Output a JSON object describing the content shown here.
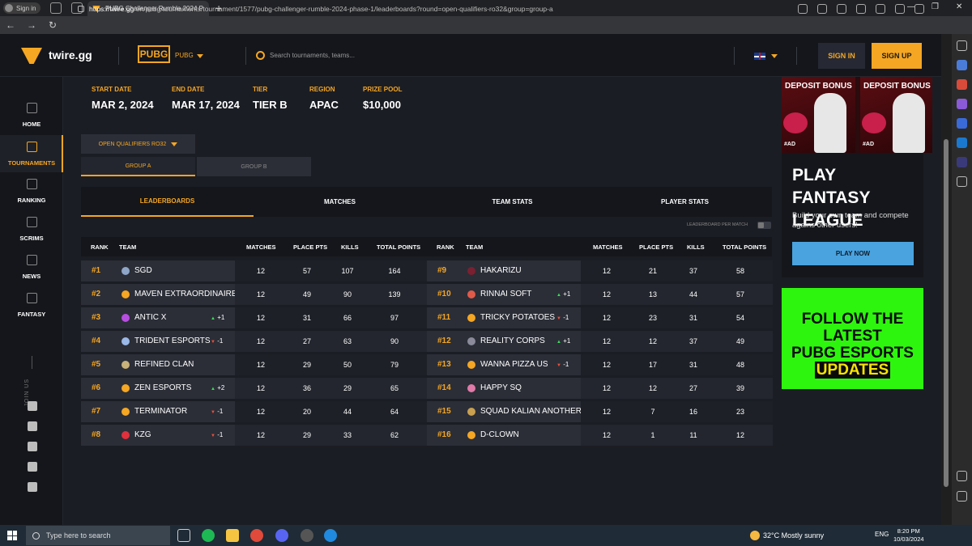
{
  "browser": {
    "profile_label": "Sign in",
    "tab_title": "PUBG Challenger Rumble 2024 P",
    "url_host": "https://twire.gg",
    "url_path": "/en/pubg/tournaments/tournament/1577/pubg-challenger-rumble-2024-phase-1/leaderboards?round=open-qualifiers-ro32&group=group-a"
  },
  "header": {
    "logo_text": "twire.gg",
    "game_logo": "PUBG",
    "game_name": "PUBG",
    "search_placeholder": "Search tournaments, teams...",
    "language_flag": "uk-flag-icon",
    "signin_label": "SIGN IN",
    "signup_label": "SIGN UP"
  },
  "sidebar": {
    "items": [
      {
        "label": "HOME",
        "icon": "home-icon"
      },
      {
        "label": "TOURNAMENTS",
        "icon": "trophy-icon"
      },
      {
        "label": "RANKING",
        "icon": "ranking-icon"
      },
      {
        "label": "SCRIMS",
        "icon": "crossed-swords-icon"
      },
      {
        "label": "NEWS",
        "icon": "news-icon"
      },
      {
        "label": "FANTASY",
        "icon": "shield-icon"
      }
    ],
    "join_us": "JOIN US",
    "social": [
      "facebook-icon",
      "twitter-icon",
      "discord-icon",
      "instagram-icon",
      "linkedin-icon"
    ]
  },
  "tournament": {
    "start_label": "START DATE",
    "start_value": "MAR 2, 2024",
    "end_label": "END DATE",
    "end_value": "MAR 17, 2024",
    "tier_label": "TIER",
    "tier_value": "TIER B",
    "region_label": "REGION",
    "region_value": "APAC",
    "prize_label": "PRIZE POOL",
    "prize_value": "$10,000"
  },
  "round_select": "OPEN QUALIFIERS RO32",
  "groups": [
    "GROUP A",
    "GROUP B"
  ],
  "tabs": [
    "LEADERBOARDS",
    "MATCHES",
    "TEAM STATS",
    "PLAYER STATS"
  ],
  "leaderboard_toggle_label": "LEADERBOARD PER MATCH",
  "columns": [
    "RANK",
    "TEAM",
    "MATCHES",
    "PLACE PTS",
    "KILLS",
    "TOTAL POINTS"
  ],
  "left_rows": [
    {
      "rank": "#1",
      "team": "SGD",
      "change": "",
      "dir": "",
      "matches": "12",
      "place": "57",
      "kills": "107",
      "total": "164",
      "color": "#8fa6c8"
    },
    {
      "rank": "#2",
      "team": "MAVEN EXTRAORDINAIRE",
      "change": "",
      "dir": "",
      "matches": "12",
      "place": "49",
      "kills": "90",
      "total": "139",
      "color": "#f5a623"
    },
    {
      "rank": "#3",
      "team": "ANTIC X",
      "change": "+1",
      "dir": "up",
      "matches": "12",
      "place": "31",
      "kills": "66",
      "total": "97",
      "color": "#b84ee0"
    },
    {
      "rank": "#4",
      "team": "TRIDENT ESPORTS",
      "change": "-1",
      "dir": "down",
      "matches": "12",
      "place": "27",
      "kills": "63",
      "total": "90",
      "color": "#9ab8e8"
    },
    {
      "rank": "#5",
      "team": "REFINED CLAN",
      "change": "",
      "dir": "",
      "matches": "12",
      "place": "29",
      "kills": "50",
      "total": "79",
      "color": "#c8b27a"
    },
    {
      "rank": "#6",
      "team": "ZEN ESPORTS",
      "change": "+2",
      "dir": "up",
      "matches": "12",
      "place": "36",
      "kills": "29",
      "total": "65",
      "color": "#f5a623"
    },
    {
      "rank": "#7",
      "team": "TERMINATOR",
      "change": "-1",
      "dir": "down",
      "matches": "12",
      "place": "20",
      "kills": "44",
      "total": "64",
      "color": "#f5a623"
    },
    {
      "rank": "#8",
      "team": "KZG",
      "change": "-1",
      "dir": "down",
      "matches": "12",
      "place": "29",
      "kills": "33",
      "total": "62",
      "color": "#e0303c"
    }
  ],
  "right_rows": [
    {
      "rank": "#9",
      "team": "HAKARIZU",
      "change": "",
      "dir": "",
      "matches": "12",
      "place": "21",
      "kills": "37",
      "total": "58",
      "color": "#7a2030"
    },
    {
      "rank": "#10",
      "team": "RINNAI SOFT",
      "change": "+1",
      "dir": "up",
      "matches": "12",
      "place": "13",
      "kills": "44",
      "total": "57",
      "color": "#e05a4a"
    },
    {
      "rank": "#11",
      "team": "TRICKY POTATOES",
      "change": "-1",
      "dir": "down",
      "matches": "12",
      "place": "23",
      "kills": "31",
      "total": "54",
      "color": "#f5a623"
    },
    {
      "rank": "#12",
      "team": "REALITY CORPS",
      "change": "+1",
      "dir": "up",
      "matches": "12",
      "place": "12",
      "kills": "37",
      "total": "49",
      "color": "#8a8a9a"
    },
    {
      "rank": "#13",
      "team": "WANNA PIZZA US",
      "change": "-1",
      "dir": "down",
      "matches": "12",
      "place": "17",
      "kills": "31",
      "total": "48",
      "color": "#f5a623"
    },
    {
      "rank": "#14",
      "team": "HAPPY SQ",
      "change": "",
      "dir": "",
      "matches": "12",
      "place": "12",
      "kills": "27",
      "total": "39",
      "color": "#e07aa8"
    },
    {
      "rank": "#15",
      "team": "SQUAD KALIAN ANOTHER",
      "change": "",
      "dir": "",
      "matches": "12",
      "place": "7",
      "kills": "16",
      "total": "23",
      "color": "#c8a050"
    },
    {
      "rank": "#16",
      "team": "D-CLOWN",
      "change": "",
      "dir": "",
      "matches": "12",
      "place": "1",
      "kills": "11",
      "total": "12",
      "color": "#f5a623"
    }
  ],
  "ads": {
    "deposit_title": "DEPOSIT BONUS",
    "ao_tag": "#AD",
    "fantasy_title": "PLAY FANTASY LEAGUE",
    "fantasy_sub": "Build your own team and compete agains other users!",
    "fantasy_button": "PLAY NOW",
    "follow_line1": "FOLLOW THE LATEST",
    "follow_line2": "PUBG ESPORTS",
    "follow_line3": "UPDATES"
  },
  "taskbar": {
    "search_placeholder": "Type here to search",
    "weather": "32°C  Mostly sunny",
    "lang": "ENG",
    "time": "8:20 PM",
    "date": "10/03/2024"
  }
}
